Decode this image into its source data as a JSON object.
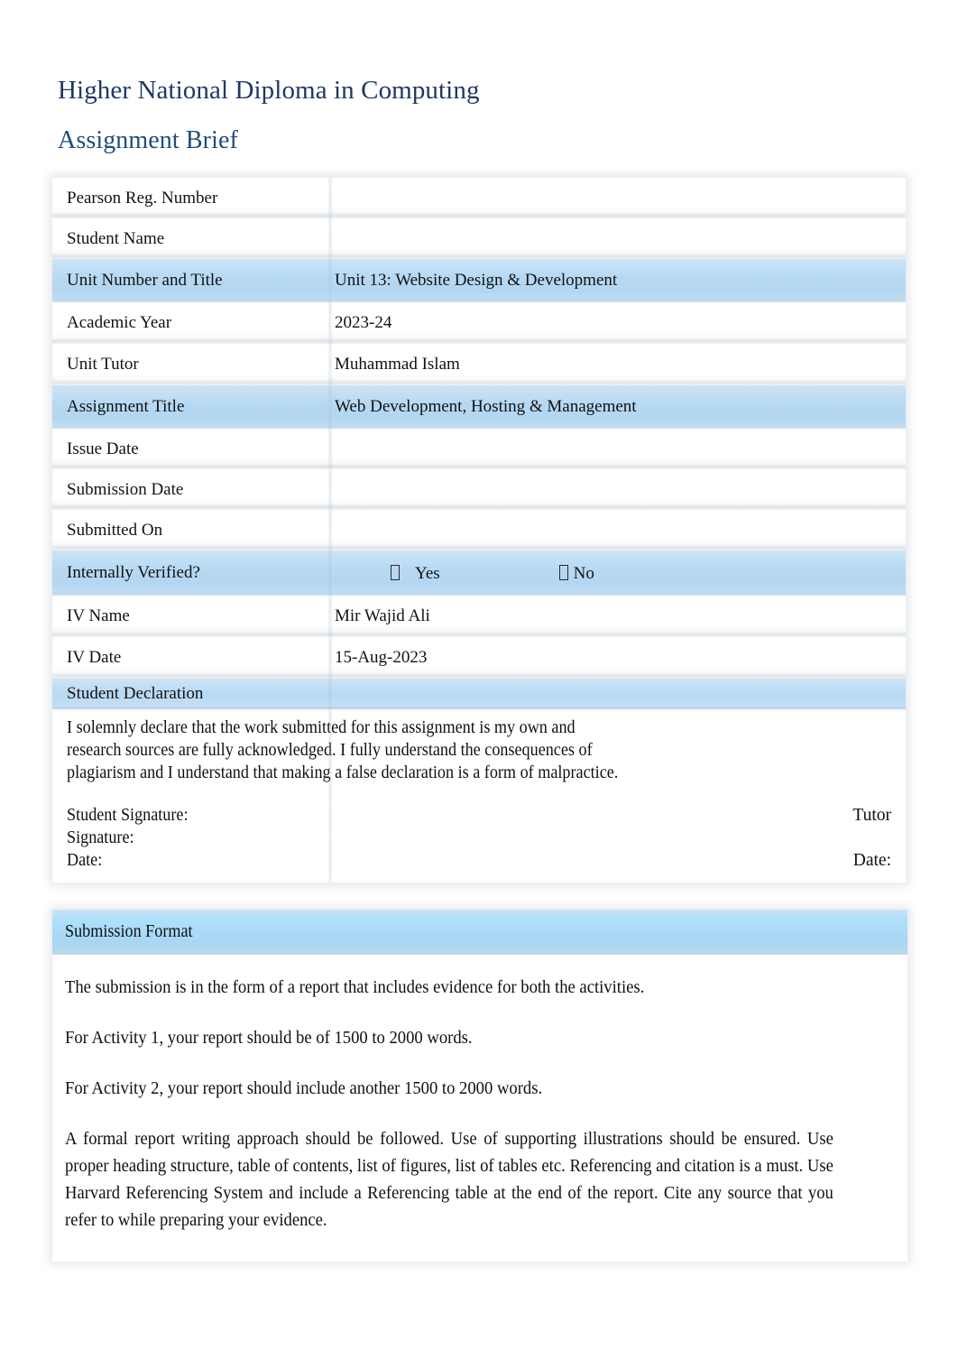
{
  "document": {
    "title": "Higher National Diploma in Computing",
    "subtitle": "Assignment Brief"
  },
  "info_table": {
    "rows": [
      {
        "label": "Pearson Reg. Number",
        "value": "",
        "highlight": false
      },
      {
        "label": "Student Name",
        "value": "",
        "highlight": false
      },
      {
        "label": "Unit Number and Title",
        "value": " Unit 13: Website Design & Development",
        "highlight": true
      },
      {
        "label": "Academic Year",
        "value": "2023-24",
        "highlight": false
      },
      {
        "label": "Unit Tutor",
        "value": "Muhammad Islam",
        "highlight": false
      },
      {
        "label": "Assignment Title",
        "value": "Web Development, Hosting & Management",
        "highlight": true
      },
      {
        "label": "Issue Date",
        "value": "",
        "highlight": false
      },
      {
        "label": "Submission Date",
        "value": "",
        "highlight": false
      },
      {
        "label": "Submitted On",
        "value": "",
        "highlight": false
      }
    ],
    "internally_verified": {
      "label": "Internally Verified?",
      "yes_label": "Yes",
      "no_label": "No",
      "checkbox_icon": "empty-checkbox-glyph"
    },
    "iv_name": {
      "label": "IV Name",
      "value": "Mir Wajid Ali"
    },
    "iv_date": {
      "label": "IV Date",
      "value": "15-Aug-2023"
    }
  },
  "student_declaration": {
    "header": "Student Declaration",
    "paragraph_lines": [
      "I solemnly declare that the work submitted for this assignment is my own and",
      "research sources are fully acknowledged. I fully understand the consequences of",
      "plagiarism and I understand that making a false declaration is a form of malpractice."
    ],
    "student_signature_label": "Student Signature:",
    "tutor_label": "Tutor",
    "signature_label": "Signature:",
    "date_label_left": "Date:",
    "date_label_right": "Date:"
  },
  "submission_format": {
    "header": "Submission Format",
    "paragraphs": [
      "The submission is in the form of a report that includes evidence for both the activities.",
      "For Activity 1, your report should be of 1500 to 2000 words.",
      "For Activity 2, your report should include another 1500 to 2000 words.",
      "A formal report writing approach should be followed. Use of supporting illustrations should be ensured. Use proper heading structure, table of contents, list of figures, list of tables etc. Referencing and citation is a must. Use Harvard Referencing System and include a Referencing table at the end of the report. Cite any source that you refer to while preparing your evidence."
    ]
  },
  "colors": {
    "title": "#1f3864",
    "subtitle": "#1f4e79",
    "row_highlight": "#b6d8f2",
    "header_blue": "#ace0fb",
    "text": "#121212",
    "page_background": "#ffffff"
  }
}
